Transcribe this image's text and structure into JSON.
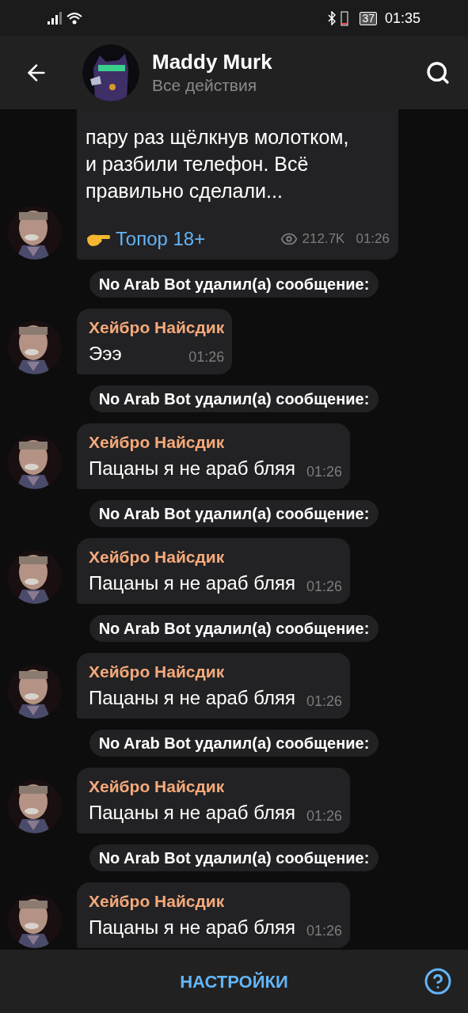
{
  "status_bar": {
    "battery": "37",
    "time": "01:35"
  },
  "header": {
    "title": "Maddy Murk",
    "subtitle": "Все действия"
  },
  "messages": [
    {
      "kind": "post",
      "text": "пару раз щёлкнув молотком, и разбили телефон. Всё правильно сделали...",
      "link": "Топор 18+",
      "views": "212.7K",
      "time": "01:26"
    },
    {
      "kind": "service",
      "text": "No Arab Bot удалил(а) сообщение:"
    },
    {
      "kind": "message",
      "author": "Хейбро Найсдик",
      "text": "Эээ",
      "time": "01:26"
    },
    {
      "kind": "service",
      "text": "No Arab Bot удалил(а) сообщение:"
    },
    {
      "kind": "message",
      "author": "Хейбро Найсдик",
      "text": "Пацаны я не араб бляя",
      "time": "01:26"
    },
    {
      "kind": "service",
      "text": "No Arab Bot удалил(а) сообщение:"
    },
    {
      "kind": "message",
      "author": "Хейбро Найсдик",
      "text": "Пацаны я не араб бляя",
      "time": "01:26"
    },
    {
      "kind": "service",
      "text": "No Arab Bot удалил(а) сообщение:"
    },
    {
      "kind": "message",
      "author": "Хейбро Найсдик",
      "text": "Пацаны я не араб бляя",
      "time": "01:26"
    },
    {
      "kind": "service",
      "text": "No Arab Bot удалил(а) сообщение:"
    },
    {
      "kind": "message",
      "author": "Хейбро Найсдик",
      "text": "Пацаны я не араб бляя",
      "time": "01:26"
    },
    {
      "kind": "service",
      "text": "No Arab Bot удалил(а) сообщение:"
    },
    {
      "kind": "message",
      "author": "Хейбро Найсдик",
      "text": "Пацаны я не араб бляя",
      "time": "01:26"
    }
  ],
  "bottom_bar": {
    "button": "НАСТРОЙКИ"
  }
}
